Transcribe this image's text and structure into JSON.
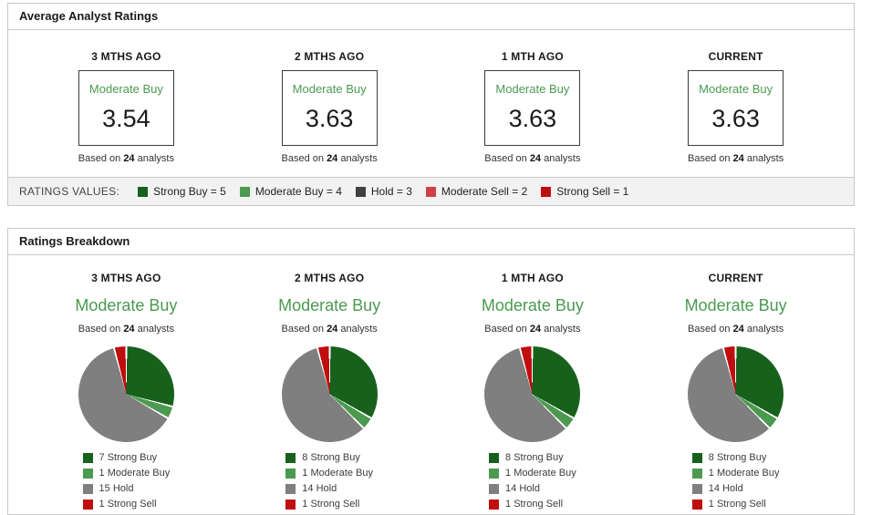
{
  "colors": {
    "strong_buy": "#17611d",
    "moderate_buy": "#4c9a50",
    "hold_pie": "#7f7f7f",
    "hold_dark": "#404040",
    "moderate_sell": "#cf4146",
    "strong_sell": "#c00d0e",
    "rating_text_green": "#4a9a50"
  },
  "avg": {
    "title": "Average Analyst Ratings",
    "columns": [
      {
        "period": "3 MTHS AGO",
        "rating": "Moderate Buy",
        "value": "3.54",
        "based_prefix": "Based on",
        "count": "24",
        "based_suffix": "analysts"
      },
      {
        "period": "2 MTHS AGO",
        "rating": "Moderate Buy",
        "value": "3.63",
        "based_prefix": "Based on",
        "count": "24",
        "based_suffix": "analysts"
      },
      {
        "period": "1 MTH AGO",
        "rating": "Moderate Buy",
        "value": "3.63",
        "based_prefix": "Based on",
        "count": "24",
        "based_suffix": "analysts"
      },
      {
        "period": "CURRENT",
        "rating": "Moderate Buy",
        "value": "3.63",
        "based_prefix": "Based on",
        "count": "24",
        "based_suffix": "analysts"
      }
    ]
  },
  "ratings_values": {
    "label": "RATINGS VALUES:",
    "items": [
      {
        "label": "Strong Buy = 5",
        "color": "#17611d"
      },
      {
        "label": "Moderate Buy = 4",
        "color": "#4c9a50"
      },
      {
        "label": "Hold = 3",
        "color": "#404040"
      },
      {
        "label": "Moderate Sell = 2",
        "color": "#cf4146"
      },
      {
        "label": "Strong Sell = 1",
        "color": "#c00d0e"
      }
    ]
  },
  "breakdown": {
    "title": "Ratings Breakdown",
    "columns": [
      {
        "period": "3 MTHS AGO",
        "rating": "Moderate Buy",
        "based_prefix": "Based on",
        "count": "24",
        "based_suffix": "analysts",
        "slices": [
          {
            "label": "7 Strong Buy",
            "value": 7,
            "color": "#17611d"
          },
          {
            "label": "1 Moderate Buy",
            "value": 1,
            "color": "#4c9a50"
          },
          {
            "label": "15 Hold",
            "value": 15,
            "color": "#7f7f7f"
          },
          {
            "label": "1 Strong Sell",
            "value": 1,
            "color": "#c00d0e"
          }
        ]
      },
      {
        "period": "2 MTHS AGO",
        "rating": "Moderate Buy",
        "based_prefix": "Based on",
        "count": "24",
        "based_suffix": "analysts",
        "slices": [
          {
            "label": "8 Strong Buy",
            "value": 8,
            "color": "#17611d"
          },
          {
            "label": "1 Moderate Buy",
            "value": 1,
            "color": "#4c9a50"
          },
          {
            "label": "14 Hold",
            "value": 14,
            "color": "#7f7f7f"
          },
          {
            "label": "1 Strong Sell",
            "value": 1,
            "color": "#c00d0e"
          }
        ]
      },
      {
        "period": "1 MTH AGO",
        "rating": "Moderate Buy",
        "based_prefix": "Based on",
        "count": "24",
        "based_suffix": "analysts",
        "slices": [
          {
            "label": "8 Strong Buy",
            "value": 8,
            "color": "#17611d"
          },
          {
            "label": "1 Moderate Buy",
            "value": 1,
            "color": "#4c9a50"
          },
          {
            "label": "14 Hold",
            "value": 14,
            "color": "#7f7f7f"
          },
          {
            "label": "1 Strong Sell",
            "value": 1,
            "color": "#c00d0e"
          }
        ]
      },
      {
        "period": "CURRENT",
        "rating": "Moderate Buy",
        "based_prefix": "Based on",
        "count": "24",
        "based_suffix": "analysts",
        "slices": [
          {
            "label": "8 Strong Buy",
            "value": 8,
            "color": "#17611d"
          },
          {
            "label": "1 Moderate Buy",
            "value": 1,
            "color": "#4c9a50"
          },
          {
            "label": "14 Hold",
            "value": 14,
            "color": "#7f7f7f"
          },
          {
            "label": "1 Strong Sell",
            "value": 1,
            "color": "#c00d0e"
          }
        ]
      }
    ]
  },
  "chart_data": [
    {
      "type": "line",
      "title": "Average Analyst Ratings",
      "categories": [
        "3 MTHS AGO",
        "2 MTHS AGO",
        "1 MTH AGO",
        "CURRENT"
      ],
      "values": [
        3.54,
        3.63,
        3.63,
        3.63
      ],
      "value_labels": [
        "Moderate Buy",
        "Moderate Buy",
        "Moderate Buy",
        "Moderate Buy"
      ],
      "analysts_per_period": [
        24,
        24,
        24,
        24
      ],
      "scale_legend": [
        "Strong Buy = 5",
        "Moderate Buy = 4",
        "Hold = 3",
        "Moderate Sell = 2",
        "Strong Sell = 1"
      ],
      "ylim": [
        1,
        5
      ]
    },
    {
      "type": "pie",
      "title": "3 MTHS AGO",
      "subtitle": "Moderate Buy",
      "total": 24,
      "categories": [
        "Strong Buy",
        "Moderate Buy",
        "Hold",
        "Strong Sell"
      ],
      "values": [
        7,
        1,
        15,
        1
      ],
      "legend_position": "bottom",
      "start_angle_deg": 0,
      "direction": "clockwise"
    },
    {
      "type": "pie",
      "title": "2 MTHS AGO",
      "subtitle": "Moderate Buy",
      "total": 24,
      "categories": [
        "Strong Buy",
        "Moderate Buy",
        "Hold",
        "Strong Sell"
      ],
      "values": [
        8,
        1,
        14,
        1
      ],
      "legend_position": "bottom",
      "start_angle_deg": 0,
      "direction": "clockwise"
    },
    {
      "type": "pie",
      "title": "1 MTH AGO",
      "subtitle": "Moderate Buy",
      "total": 24,
      "categories": [
        "Strong Buy",
        "Moderate Buy",
        "Hold",
        "Strong Sell"
      ],
      "values": [
        8,
        1,
        14,
        1
      ],
      "legend_position": "bottom",
      "start_angle_deg": 0,
      "direction": "clockwise"
    },
    {
      "type": "pie",
      "title": "CURRENT",
      "subtitle": "Moderate Buy",
      "total": 24,
      "categories": [
        "Strong Buy",
        "Moderate Buy",
        "Hold",
        "Strong Sell"
      ],
      "values": [
        8,
        1,
        14,
        1
      ],
      "legend_position": "bottom",
      "start_angle_deg": 0,
      "direction": "clockwise"
    }
  ]
}
